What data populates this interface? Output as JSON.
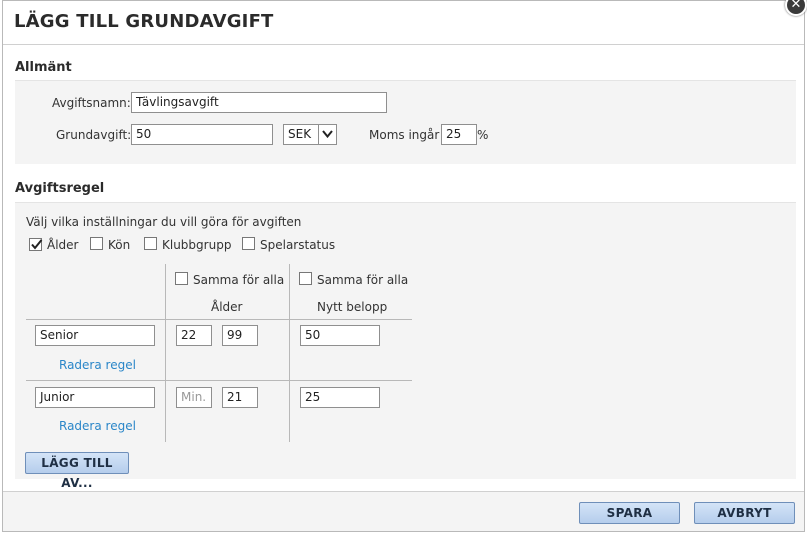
{
  "dialog": {
    "title": "LÄGG TILL GRUNDAVGIFT",
    "close_glyph": "✕"
  },
  "general": {
    "heading": "Allmänt",
    "fee_name_label": "Avgiftsnamn:",
    "fee_name_value": "Tävlingsavgift",
    "base_fee_label": "Grundavgift:",
    "base_fee_value": "50",
    "currency_value": "SEK",
    "vat_label": "Moms ingår",
    "vat_value": "25",
    "vat_unit": "%"
  },
  "rule": {
    "heading": "Avgiftsregel",
    "instruction": "Välj vilka inställningar du vill göra för avgiften",
    "options": [
      {
        "label": "Ålder",
        "checked": true
      },
      {
        "label": "Kön",
        "checked": false
      },
      {
        "label": "Klubbgrupp",
        "checked": false
      },
      {
        "label": "Spelarstatus",
        "checked": false
      }
    ],
    "same_for_all_label": "Samma för alla",
    "age_header": "Ålder",
    "amount_header": "Nytt belopp",
    "rows": [
      {
        "name": "Senior",
        "min": "22",
        "max": "99",
        "amount": "50",
        "delete_label": "Radera regel"
      },
      {
        "name": "Junior",
        "min": "",
        "min_placeholder": "Min.",
        "max": "21",
        "amount": "25",
        "delete_label": "Radera regel"
      }
    ],
    "add_button_label": "LÄGG TILL AV..."
  },
  "footer": {
    "save_label": "SPARA",
    "cancel_label": "AVBRYT"
  },
  "colors": {
    "link": "#2a86c8",
    "button_top": "#d4e4f7",
    "button_bottom": "#b5cdec",
    "panel_bg": "#f4f4f4"
  },
  "icons": {
    "close": "close-icon",
    "dropdown": "chevron-down-icon",
    "checkbox_checked": "checkmark-icon"
  }
}
